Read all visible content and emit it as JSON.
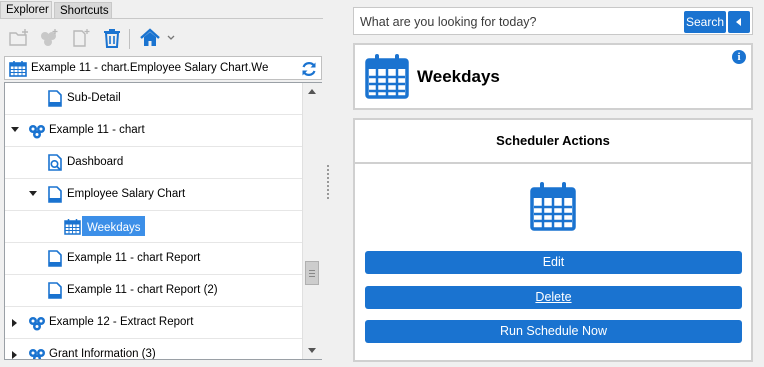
{
  "tabs": [
    {
      "label": "Explorer",
      "active": true
    },
    {
      "label": "Shortcuts",
      "active": false
    }
  ],
  "toolbar": {
    "icons": [
      "new-folder-icon",
      "copy-icon",
      "new-item-icon",
      "delete-icon",
      "home-icon"
    ]
  },
  "path": {
    "text": "Example 11 - chart.Employee Salary Chart.We"
  },
  "tree": {
    "rows": [
      {
        "label": "Sub-Detail",
        "icon": "document-icon",
        "arrow": "none"
      },
      {
        "label": "Example 11 - chart",
        "icon": "cubes-icon",
        "arrow": "down"
      },
      {
        "label": "Dashboard",
        "icon": "dashboard-icon",
        "arrow": "none"
      },
      {
        "label": "Employee Salary Chart",
        "icon": "document-icon",
        "arrow": "down"
      },
      {
        "label": "Weekdays",
        "icon": "calendar-icon",
        "arrow": "none",
        "selected": true
      },
      {
        "label": "Example 11 - chart Report",
        "icon": "document-icon",
        "arrow": "none"
      },
      {
        "label": "Example 11 - chart Report (2)",
        "icon": "document-icon",
        "arrow": "none"
      },
      {
        "label": "Example 12 - Extract Report",
        "icon": "cubes-icon",
        "arrow": "right"
      },
      {
        "label": "Grant Information (3)",
        "icon": "cubes-icon",
        "arrow": "right"
      }
    ]
  },
  "search": {
    "placeholder": "What are you looking for today?",
    "button_label": "Search"
  },
  "detail": {
    "title": "Weekdays",
    "info_label": "i"
  },
  "actions": {
    "heading": "Scheduler Actions",
    "edit_label": "Edit",
    "delete_label": "Delete",
    "run_label": "Run Schedule Now"
  },
  "colors": {
    "accent": "#1a73d0",
    "selection": "#3c8fe8"
  }
}
